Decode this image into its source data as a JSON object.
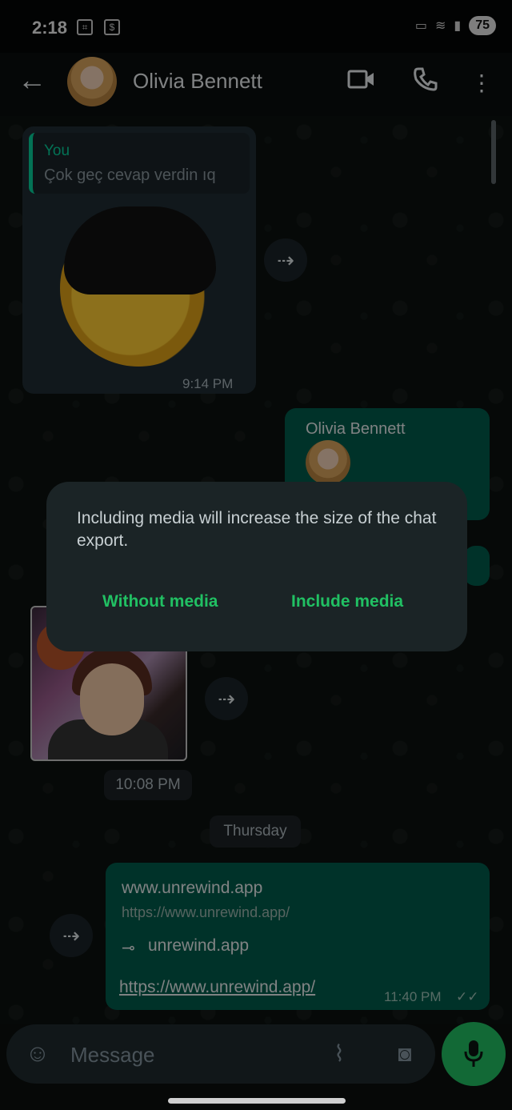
{
  "status_bar": {
    "time": "2:18",
    "battery": "75"
  },
  "header": {
    "contact_name": "Olivia Bennett",
    "back_icon": "arrow-left-icon",
    "video_icon": "video-call-icon",
    "call_icon": "phone-icon",
    "menu_icon": "more-vert-icon"
  },
  "messages": {
    "quoted": {
      "author": "You",
      "text": "Çok geç cevap verdin ıq"
    },
    "sticker_time": "9:14 PM",
    "shared_contact_name": "Olivia Bennett",
    "image_time": "10:08 PM",
    "date_separator": "Thursday",
    "link_preview": {
      "title": "www.unrewind.app",
      "url": "https://www.unrewind.app/",
      "domain": "unrewind.app",
      "body": "https://www.unrewind.app/",
      "time": "11:40 PM"
    }
  },
  "dialog": {
    "message": "Including media will increase the size of the chat export.",
    "without_media": "Without media",
    "include_media": "Include media"
  },
  "composer": {
    "placeholder": "Message"
  },
  "colors": {
    "accent": "#21c063",
    "outgoing_bubble": "#005c4b",
    "incoming_bubble": "#1f2c33"
  }
}
